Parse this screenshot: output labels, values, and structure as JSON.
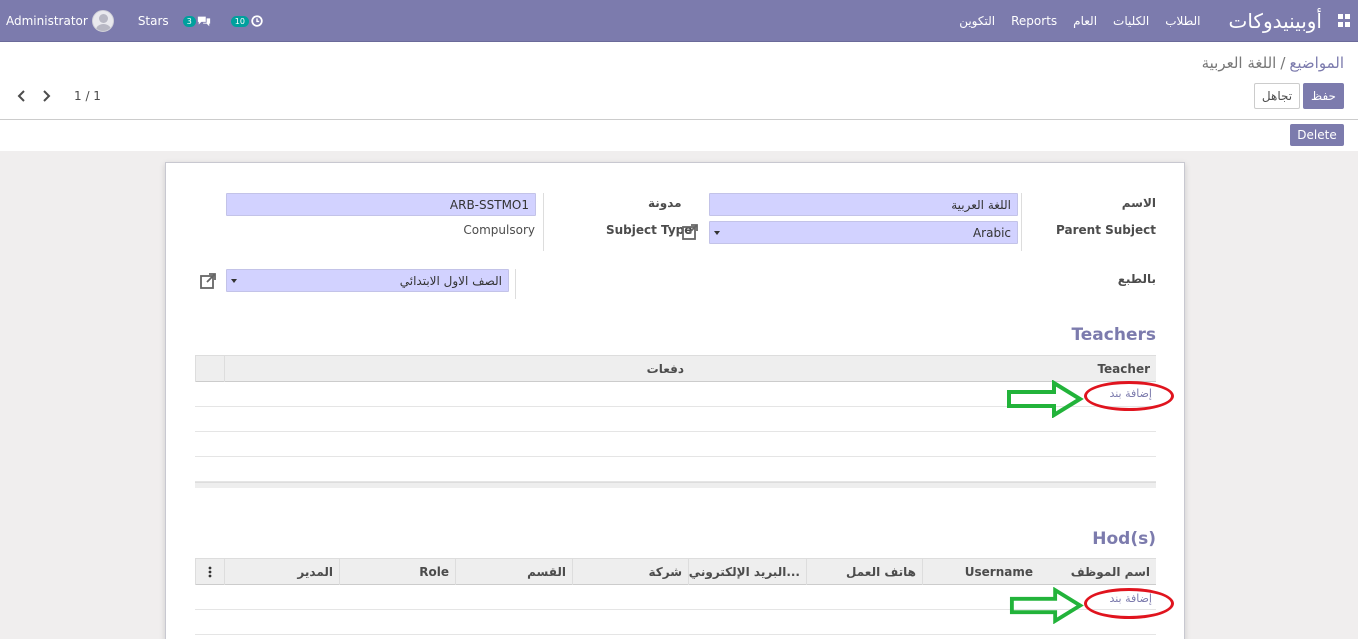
{
  "navbar": {
    "user": "Administrator",
    "stars": "Stars",
    "messages_count": "3",
    "activities_count": "10",
    "brand": "أوبينيدوكات",
    "menu": [
      "الطلاب",
      "الكليات",
      "العام",
      "Reports",
      "التكوين"
    ]
  },
  "breadcrumb": {
    "parent": "المواضيع",
    "separator": "/",
    "current": "اللغة العربية"
  },
  "buttons": {
    "save": "حفظ",
    "discard": "تجاهل",
    "delete": "Delete"
  },
  "pager": {
    "value": "1 / 1"
  },
  "form": {
    "name_label": "الاسم",
    "name_value": "اللغة العربية",
    "parent_subject_label": "Parent Subject",
    "parent_subject_value": "Arabic",
    "code_label": "مدونة",
    "code_value": "ARB-SSTMO1",
    "subject_type_label": "Subject Type",
    "subject_type_value": "Compulsory",
    "grade_label": "بالطبع",
    "grade_value": "الصف الاول الابتدائي"
  },
  "teachers": {
    "title": "Teachers",
    "columns": [
      "Teacher",
      "دفعات"
    ],
    "add_line": "إضافة بند"
  },
  "hods": {
    "title": "Hod(s)",
    "columns": [
      "اسم الموظف",
      "Username",
      "هاتف العمل",
      "البريد الإلكتروني للعـ...",
      "شركة",
      "القسم",
      "Role",
      "المدير"
    ],
    "add_line": "إضافة بند"
  },
  "colors": {
    "brand": "#7c7bad",
    "field_bg": "#d2d2ff",
    "annotation_red": "#e0141e",
    "annotation_green": "#22b33a"
  }
}
